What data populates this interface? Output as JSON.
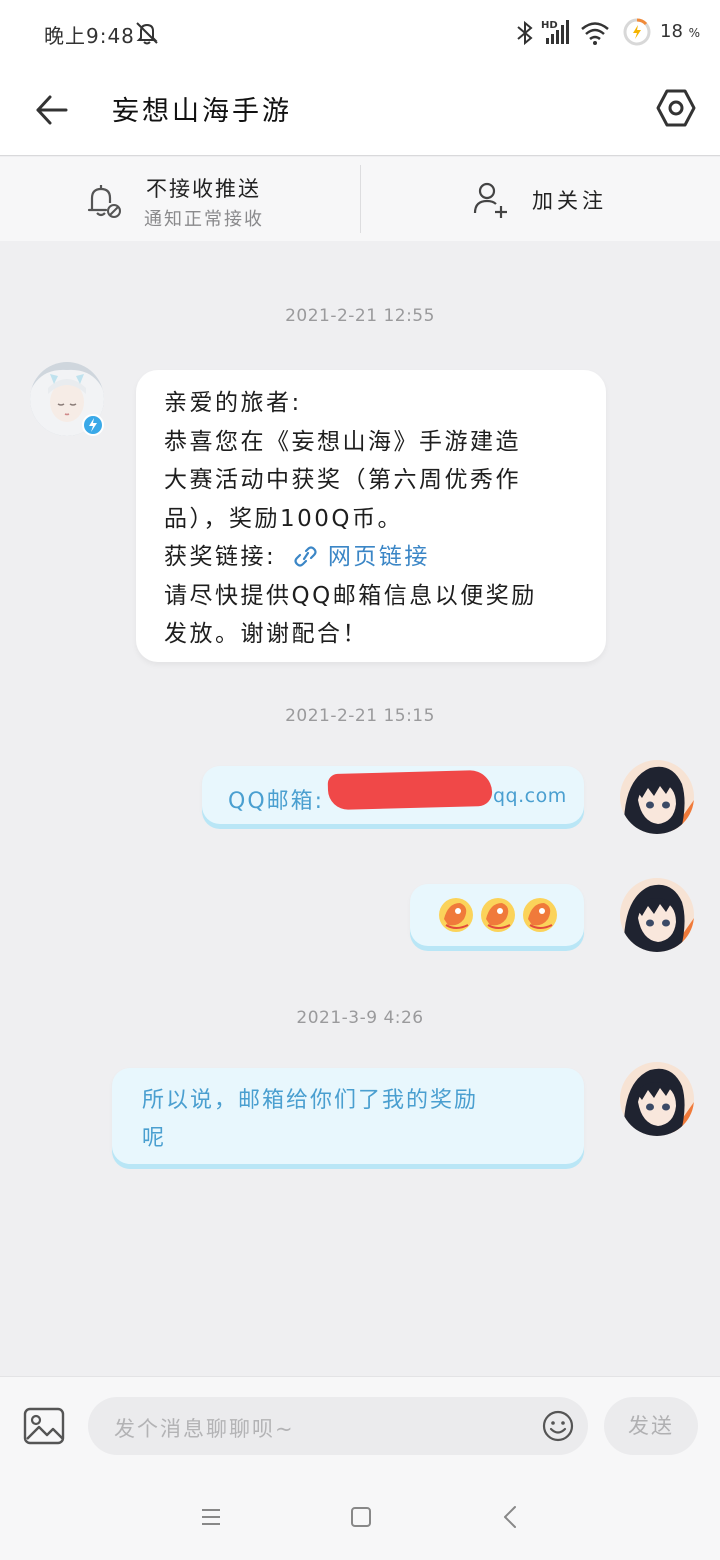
{
  "status_bar": {
    "time": "晚上9:48",
    "battery": "18",
    "battery_unit": "%",
    "icons": [
      "mute-icon",
      "bluetooth-icon",
      "hd-signal-icon",
      "wifi-icon",
      "battery-saver-icon"
    ]
  },
  "header": {
    "title": "妄想山海手游",
    "back_icon": "back-arrow-icon",
    "settings_icon": "settings-hexagon-icon"
  },
  "action_bar": {
    "push_title": "不接收推送",
    "push_subtitle": "通知正常接收",
    "follow_label": "加关注"
  },
  "chat": {
    "messages": [
      {
        "timestamp": "2021-2-21  12:55",
        "direction": "incoming",
        "lines": [
          "亲爱的旅者:",
          "恭喜您在《妄想山海》手游建造",
          "大赛活动中获奖（第六周优秀作",
          "品），奖励100Q币。",
          "请尽快提供QQ邮箱信息以便奖励",
          "发放。谢谢配合！"
        ],
        "link_prefix": "获奖链接:",
        "link_text": "网页链接"
      },
      {
        "timestamp": "2021-2-21  15:15",
        "direction": "outgoing",
        "email_label": "QQ邮箱:",
        "email_suffix": "qq.com"
      },
      {
        "direction": "outgoing",
        "sticker": "koi-fish-sticker-x3"
      },
      {
        "timestamp": "2021-3-9  4:26",
        "direction": "outgoing",
        "lines": [
          "所以说，邮箱给你们了我的奖励",
          "呢"
        ]
      }
    ]
  },
  "input_bar": {
    "placeholder": "发个消息聊聊呗~",
    "send_label": "发送"
  },
  "nav_bar": {
    "icons": [
      "menu-icon",
      "home-square-icon",
      "back-chevron-icon"
    ]
  }
}
